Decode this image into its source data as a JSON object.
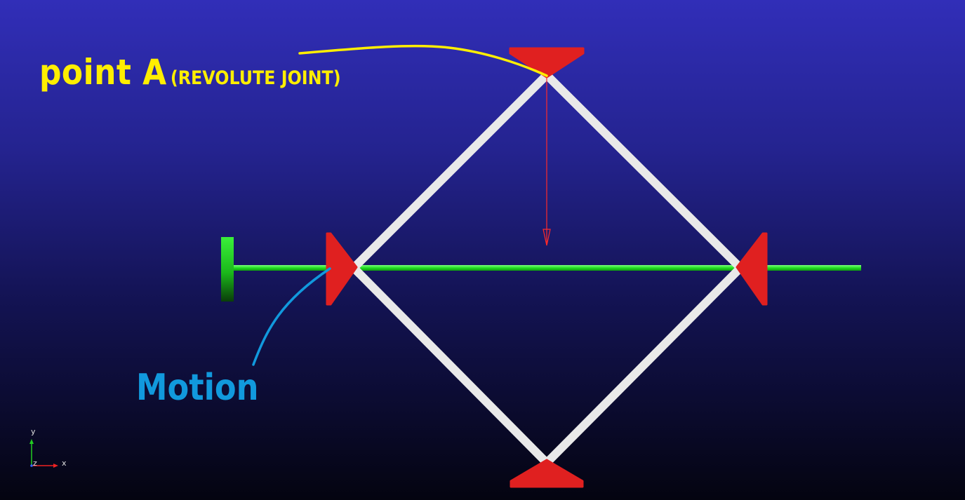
{
  "annotations": {
    "point_a": {
      "main": "point A",
      "sub": "(REVOLUTE JOINT)",
      "color": "#ffee00"
    },
    "motion": {
      "text": "Motion",
      "color": "#1199dd"
    }
  },
  "triad": {
    "y": "y",
    "z": "z",
    "x": "x",
    "color": "#e0e0e0"
  },
  "colors": {
    "link": "#e9e9e9",
    "joint": "#e02020",
    "rail": "#22e022",
    "force_arrow": "#ff2a2a"
  }
}
